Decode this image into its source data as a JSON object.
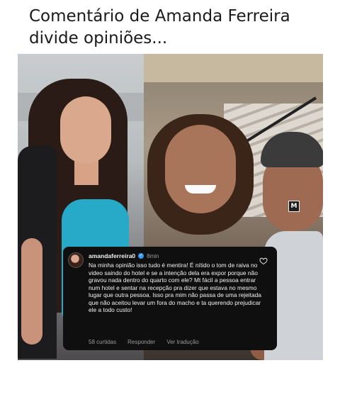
{
  "headline": {
    "line1": "Comentário de Amanda Ferreira",
    "line2": "divide opiniões..."
  },
  "watermark": "M",
  "comment": {
    "username": "amandaferreira0",
    "verified": true,
    "time": "8min",
    "text": "Na minha opinião isso tudo é mentira! É nítido o tom de raiva no video saindo do hotel e se a intenção dela era expor porque não gravou nada dentro do quarto com ele? Mt fácil a pessoa entrar num hotel e sentar na recepção pra dizer que estava no mesmo lugar que outra pessoa. Isso pra mim não passa de uma rejeitada que não aceitou levar um fora do macho e ta querendo prejudicar ele a todo custo!",
    "likes": "58 curtidas",
    "reply": "Responder",
    "translate": "Ver tradução"
  },
  "icons": {
    "verified": "verified-badge-icon",
    "like": "heart-icon"
  },
  "colors": {
    "comment_bg": "#0f0f0f",
    "verified": "#3897f0",
    "muted": "#9a9a9a"
  }
}
